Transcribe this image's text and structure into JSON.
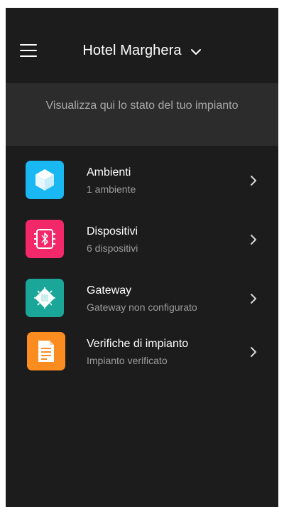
{
  "header": {
    "menu_icon": "hamburger-menu-icon",
    "title": "Hotel Marghera",
    "title_dropdown_icon": "chevron-down-icon"
  },
  "banner": {
    "text": "Visualizza qui lo stato del tuo impianto"
  },
  "list": {
    "items": [
      {
        "label": "Ambienti",
        "subtitle": "1 ambiente",
        "icon": "cube-icon",
        "color": "#1ab8f3"
      },
      {
        "label": "Dispositivi",
        "subtitle": "6 dispositivi",
        "icon": "bluetooth-device-icon",
        "color": "#f2286b"
      },
      {
        "label": "Gateway",
        "subtitle": "Gateway non configurato",
        "icon": "chip-icon",
        "color": "#1aa79a"
      },
      {
        "label": "Verifiche di impianto",
        "subtitle": "Impianto verificato",
        "icon": "document-icon",
        "color": "#fb8c1f"
      }
    ],
    "row_chevron_icon": "chevron-right-icon"
  },
  "colors": {
    "background": "#1c1c1c",
    "banner": "#2c2c2c",
    "text_primary": "#ffffff",
    "text_secondary": "#9c9c9c"
  }
}
